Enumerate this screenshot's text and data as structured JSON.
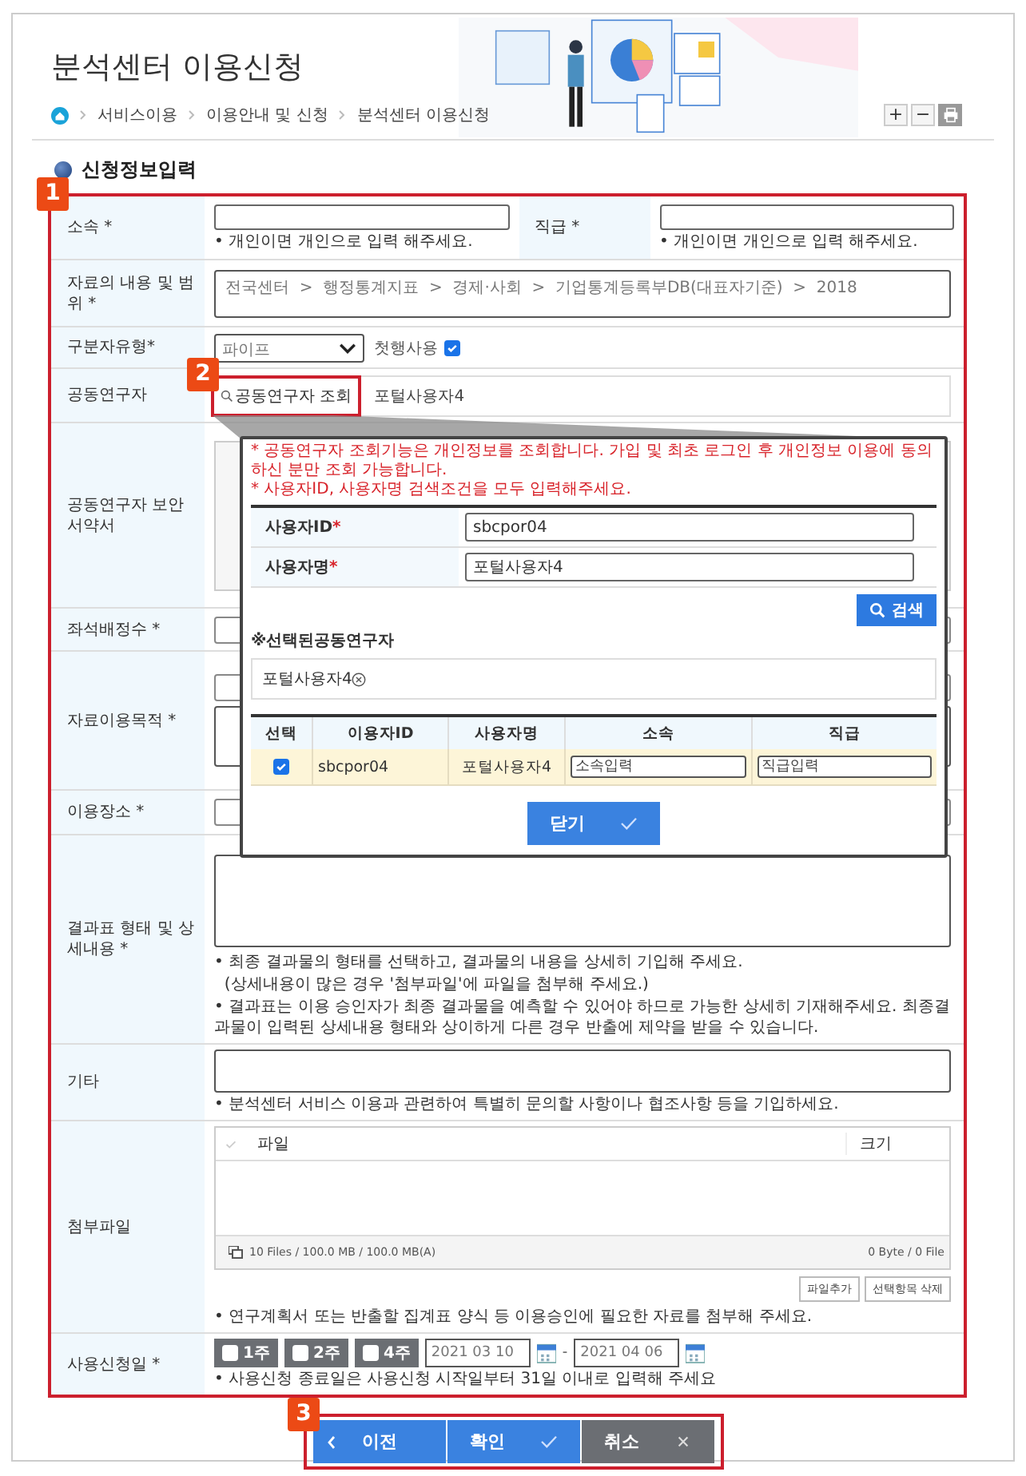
{
  "page": {
    "title": "분석센터 이용신청",
    "breadcrumb": [
      "서비스이용",
      "이용안내 및 신청",
      "분석센터 이용신청"
    ],
    "tools": [
      "+",
      "−"
    ]
  },
  "section_title": "신청정보입력",
  "callouts": [
    "1",
    "2",
    "3"
  ],
  "form": {
    "affiliation": {
      "label": "소속 *",
      "hint": "• 개인이면 개인으로 입력 해주세요."
    },
    "position": {
      "label": "직급 *",
      "hint": "• 개인이면 개인으로 입력 해주세요."
    },
    "data_scope": {
      "label": "자료의 내용 및 범위 *",
      "value": "전국센터  >  행정통계지표  >  경제·사회  >  기업통계등록부DB(대표자기준)  >  2018"
    },
    "separator_type": {
      "label": "구분자유형*",
      "value": "파이프",
      "checkbox_label": "첫행사용",
      "checked": true
    },
    "co_researchers": {
      "label": "공동연구자",
      "search_button": "공동연구자 조회",
      "chips": [
        "포털사용자4"
      ]
    },
    "security_pledge": {
      "label": "공동연구자 보안서약서"
    },
    "seats": {
      "label": "좌석배정수 *"
    },
    "purpose": {
      "label": "자료이용목적 *"
    },
    "place": {
      "label": "이용장소 *"
    },
    "result": {
      "label": "결과표 형태 및 상세내용 *",
      "notes": [
        "• 최종 결과물의 형태를 선택하고, 결과물의 내용을 상세히 기입해 주세요.",
        "  (상세내용이 많은 경우 '첨부파일'에 파일을 첨부해 주세요.)",
        "• 결과표는 이용 승인자가 최종 결과물을 예측할 수 있어야 하므로 가능한 상세히 기재해주세요. 최종결과물이 입력된 상세내용 형태와 상이하게 다른 경우 반출에 제약을 받을 수 있습니다."
      ]
    },
    "etc": {
      "label": "기타",
      "note": "• 분석센터 서비스 이용과 관련하여 특별히 문의할 사항이나 협조사항 등을 기입하세요."
    },
    "attachments": {
      "label": "첨부파일",
      "columns": [
        "파일",
        "크기"
      ],
      "summary": "10 Files / 100.0 MB / 100.0 MB(A)",
      "total": "0 Byte / 0 File",
      "buttons": [
        "파일추가",
        "선택항목 삭제"
      ],
      "note": "• 연구계획서 또는 반출할 집계표 양식 등 이용승인에 필요한 자료를 첨부해 주세요."
    },
    "date": {
      "label": "사용신청일 *",
      "periods": [
        {
          "label": "1주",
          "checked": false
        },
        {
          "label": "2주",
          "checked": false
        },
        {
          "label": "4주",
          "checked": false
        }
      ],
      "start": "2021 03 10",
      "separator": "-",
      "end": "2021 04 06",
      "note": "• 사용신청 종료일은 사용신청 시작일부터 31일 이내로 입력해 주세요"
    }
  },
  "buttons": [
    {
      "label": "이전",
      "kind": "prev"
    },
    {
      "label": "확인",
      "kind": "confirm"
    },
    {
      "label": "취소",
      "kind": "cancel"
    }
  ],
  "popup": {
    "notices": [
      "* 공동연구자 조회기능은 개인정보를 조회합니다. 가입 및 최초 로그인 후 개인정보 이용에 동의하신 분만 조회 가능합니다.",
      "* 사용자ID, 사용자명 검색조건을 모두 입력해주세요."
    ],
    "fields": [
      {
        "label": "사용자ID",
        "mark": "*",
        "value": "sbcpor04"
      },
      {
        "label": "사용자명",
        "mark": "*",
        "value": "포털사용자4"
      }
    ],
    "search_button": "검색",
    "selected_title": "※선택된공동연구자",
    "selected": [
      "포털사용자4"
    ],
    "columns": [
      "선택",
      "이용자ID",
      "사용자명",
      "소속",
      "직급"
    ],
    "rows": [
      {
        "checked": true,
        "user_id": "sbcpor04",
        "name": "포털사용자4",
        "affiliation_placeholder": "소속입력",
        "position_placeholder": "직급입력"
      }
    ],
    "close_button": "닫기"
  }
}
